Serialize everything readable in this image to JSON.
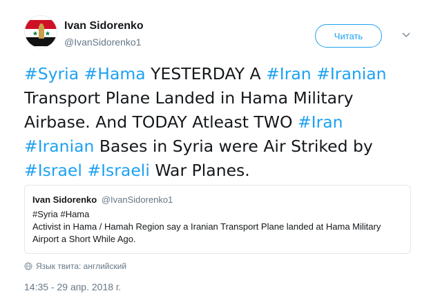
{
  "author": {
    "display_name": "Ivan Sidorenko",
    "handle": "@IvanSidorenko1",
    "avatar_icon": "syria-flag-avatar-icon"
  },
  "follow_button": {
    "label": "Читать"
  },
  "more_menu": {
    "icon": "chevron-down-icon"
  },
  "tweet_text": [
    {
      "text": "#Syria",
      "hashtag": true
    },
    {
      "text": " ",
      "hashtag": false
    },
    {
      "text": "#Hama",
      "hashtag": true
    },
    {
      "text": " YESTERDAY A ",
      "hashtag": false
    },
    {
      "text": "#Iran",
      "hashtag": true
    },
    {
      "text": " ",
      "hashtag": false
    },
    {
      "text": "#Iranian",
      "hashtag": true
    },
    {
      "text": " Transport Plane Landed in Hama Military Airbase. And TODAY Atleast TWO ",
      "hashtag": false
    },
    {
      "text": "#Iran",
      "hashtag": true
    },
    {
      "text": " ",
      "hashtag": false
    },
    {
      "text": "#Iranian",
      "hashtag": true
    },
    {
      "text": " Bases in Syria were Air Striked by ",
      "hashtag": false
    },
    {
      "text": "#Israel",
      "hashtag": true
    },
    {
      "text": " ",
      "hashtag": false
    },
    {
      "text": "#Israeli",
      "hashtag": true
    },
    {
      "text": " War Planes.",
      "hashtag": false
    }
  ],
  "quoted_tweet": {
    "display_name": "Ivan Sidorenko",
    "handle": "@IvanSidorenko1",
    "line1": "#Syria #Hama",
    "line2": "Activist in Hama / Hamah Region say a Iranian Transport Plane landed at Hama Military Airport a Short While Ago."
  },
  "language_note": "Язык твита: английский",
  "timestamp": "14:35 - 29 апр. 2018 г.",
  "colors": {
    "accent": "#1da1f2",
    "secondary_text": "#657786",
    "border": "#e1e8ed"
  }
}
